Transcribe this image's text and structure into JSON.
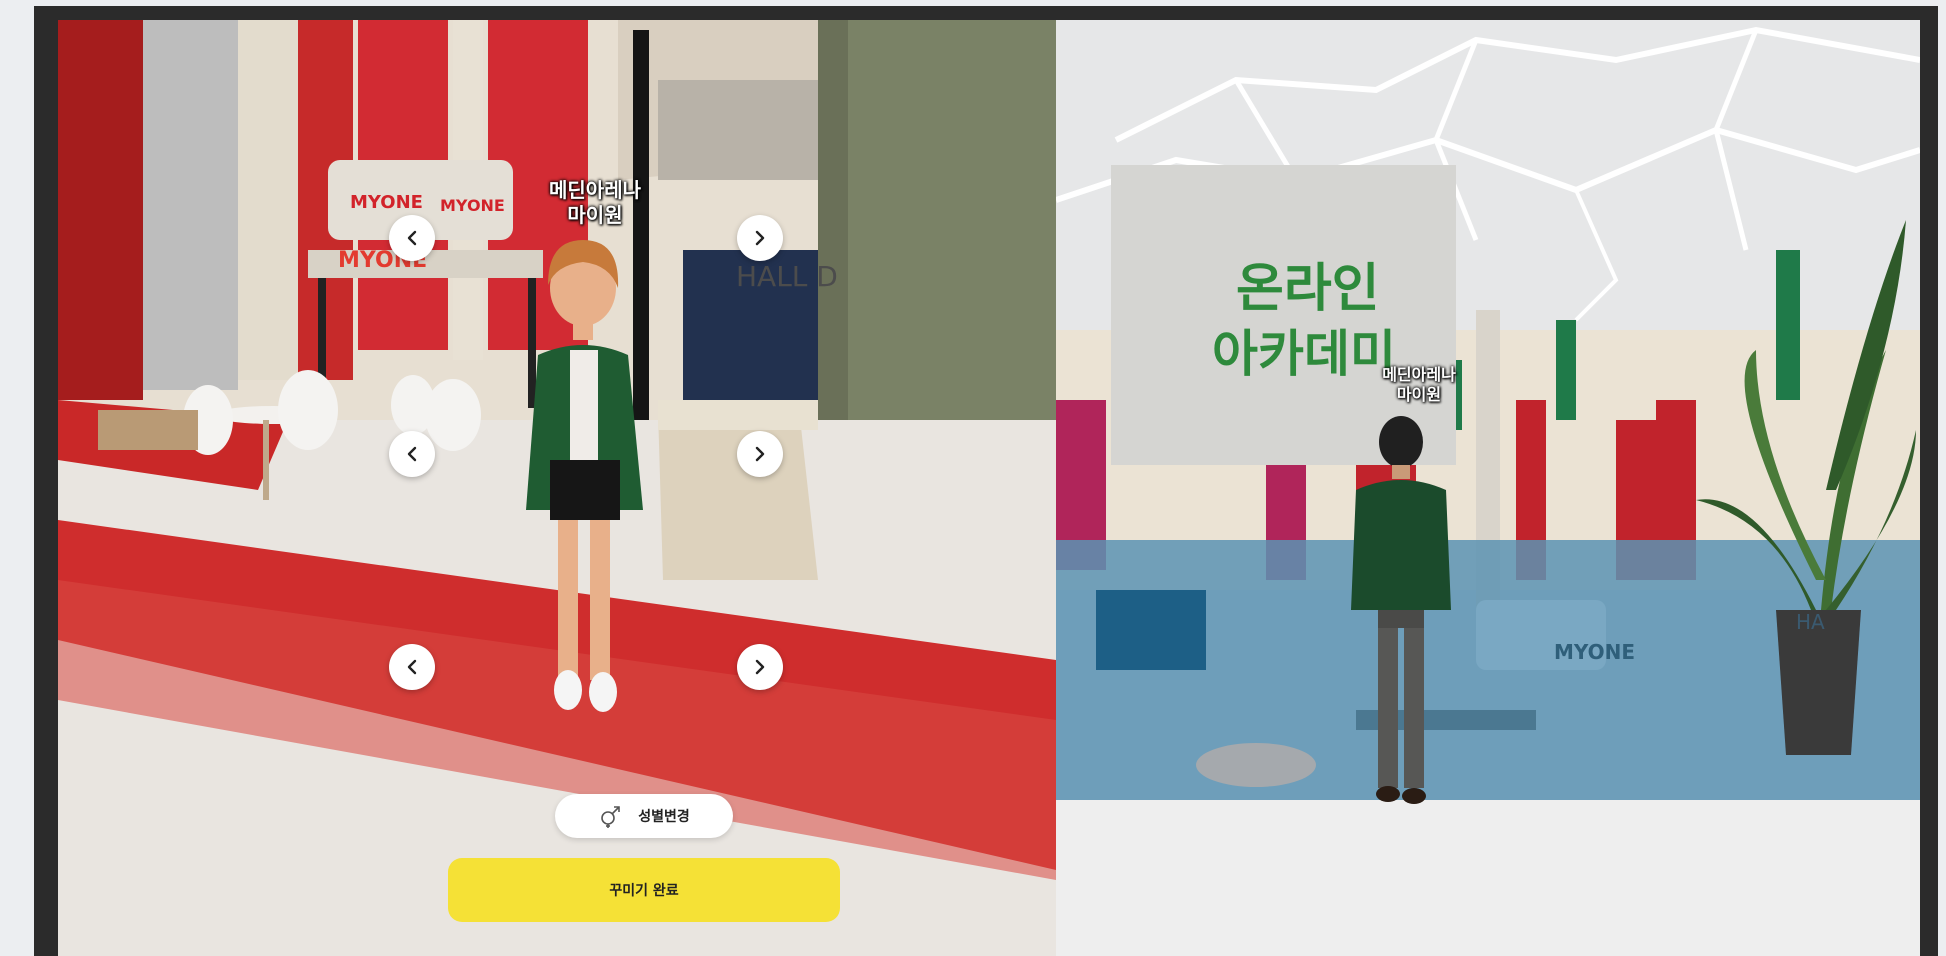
{
  "left_view": {
    "booth_logos": [
      "MYONE",
      "MYONE",
      "MYONE"
    ],
    "hall_sign": "HALL D",
    "avatar_name": {
      "line1": "메딘아레나",
      "line2": "마이원"
    },
    "nav_buttons": [
      {
        "direction": "prev",
        "icon": "chevron-left-icon"
      },
      {
        "direction": "next",
        "icon": "chevron-right-icon"
      },
      {
        "direction": "prev",
        "icon": "chevron-left-icon"
      },
      {
        "direction": "next",
        "icon": "chevron-right-icon"
      },
      {
        "direction": "prev",
        "icon": "chevron-left-icon"
      },
      {
        "direction": "next",
        "icon": "chevron-right-icon"
      }
    ],
    "gender_button": {
      "label": "성별변경",
      "icon": "gender-icon"
    },
    "done_button": {
      "label": "꾸미기 완료"
    }
  },
  "right_view": {
    "banner": {
      "title_line1": "온라인",
      "title_line2": "아카데미"
    },
    "avatar_name": {
      "line1": "메딘아레나",
      "line2": "마이원"
    },
    "booth_logo": "MYONE",
    "hall_sign": "HA"
  },
  "colors": {
    "accent_yellow": "#f5e136",
    "banner_green": "#2e8a3c",
    "wall_red": "#c8232c"
  }
}
